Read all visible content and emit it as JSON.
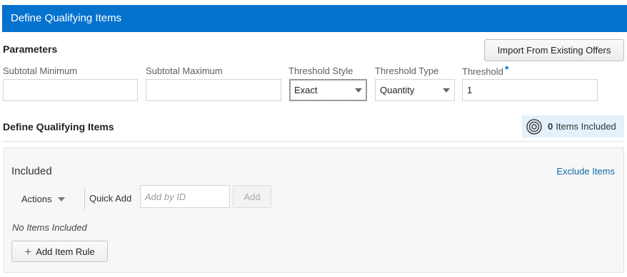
{
  "header": {
    "title": "Define Qualifying Items"
  },
  "parameters": {
    "title": "Parameters",
    "import_button": "Import From Existing Offers",
    "fields": {
      "subtotal_min": {
        "label": "Subtotal Minimum",
        "value": ""
      },
      "subtotal_max": {
        "label": "Subtotal Maximum",
        "value": ""
      },
      "threshold_style": {
        "label": "Threshold Style",
        "value": "Exact"
      },
      "threshold_type": {
        "label": "Threshold Type",
        "value": "Quantity"
      },
      "threshold": {
        "label": "Threshold",
        "required_marker": "*",
        "value": "1"
      }
    }
  },
  "qualifying": {
    "title": "Define Qualifying Items",
    "badge": {
      "count": "0",
      "label": "Items Included"
    }
  },
  "included_panel": {
    "title": "Included",
    "exclude_link": "Exclude Items",
    "actions_label": "Actions",
    "quick_add_label": "Quick Add",
    "quick_add_placeholder": "Add by ID",
    "add_button": "Add",
    "empty_text": "No Items Included",
    "add_rule_button": "Add Item Rule"
  },
  "colors": {
    "header_bg": "#0572ce",
    "link": "#0c6aa8",
    "badge_bg": "#e4f0fa"
  }
}
